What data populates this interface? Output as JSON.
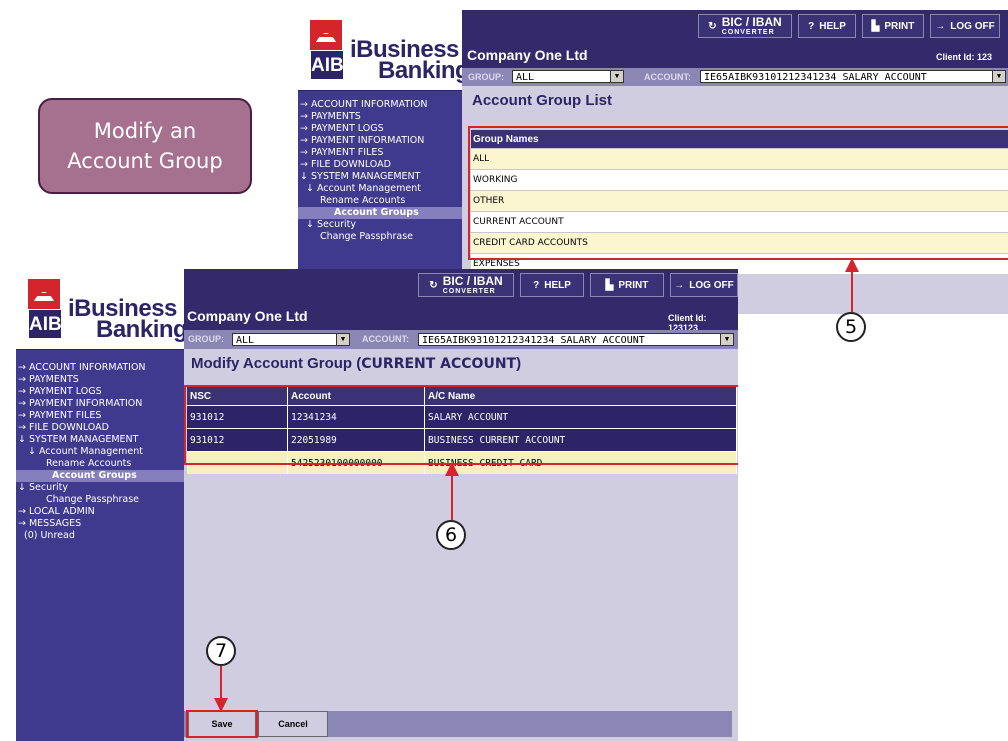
{
  "callout": {
    "line1": "Modify an",
    "line2": "Account Group"
  },
  "app": {
    "logo_text": "AIB",
    "brand_line1_i": "i",
    "brand_line1": "Business",
    "brand_line2": "Banking"
  },
  "toolbar": {
    "bic_top": "BIC / IBAN",
    "bic_bottom": "CONVERTER",
    "help": "HELP",
    "print": "PRINT",
    "logoff": "LOG OFF"
  },
  "company": {
    "name": "Company One Ltd",
    "client_id_1": "Client Id: 123",
    "client_id_2": "Client Id: 123123"
  },
  "filters": {
    "group_label": "GROUP:",
    "group_value": "ALL",
    "account_label": "ACCOUNT:",
    "account_value": "IE65AIBK93101212341234 SALARY ACCOUNT"
  },
  "sidebar": {
    "items": [
      "→ ACCOUNT INFORMATION",
      "→ PAYMENTS",
      "→ PAYMENT LOGS",
      "→ PAYMENT INFORMATION",
      "→ PAYMENT FILES",
      "→ FILE DOWNLOAD",
      "↓ SYSTEM MANAGEMENT",
      "↓ Account Management",
      "Rename Accounts",
      "Account Groups",
      "↓ Security",
      "Change Passphrase",
      "→ LOCAL ADMIN",
      "→ MESSAGES",
      "(0) Unread"
    ]
  },
  "group_list": {
    "title": "Account Group List",
    "header": "Group Names",
    "rows": [
      "ALL",
      "WORKING",
      "OTHER",
      "CURRENT ACCOUNT",
      "CREDIT CARD ACCOUNTS",
      "EXPENSES"
    ]
  },
  "modify": {
    "title_prefix": "Modify Account Group (",
    "group_name": "CURRENT ACCOUNT",
    "title_suffix": ")",
    "headers": [
      "NSC",
      "Account",
      "A/C Name"
    ],
    "rows": [
      [
        "931012",
        "12341234",
        "SALARY ACCOUNT"
      ],
      [
        "931012",
        "22051989",
        "BUSINESS CURRENT ACCOUNT"
      ],
      [
        "",
        "5425230100000000",
        "BUSINESS CREDIT CARD"
      ]
    ],
    "save": "Save",
    "cancel": "Cancel"
  },
  "steps": {
    "s5": "5",
    "s6": "6",
    "s7": "7"
  },
  "colors": {
    "brand": "#2d2468",
    "accent_red": "#d3252b",
    "callout": "#a6708f",
    "sidebar": "#3f3a8e"
  }
}
